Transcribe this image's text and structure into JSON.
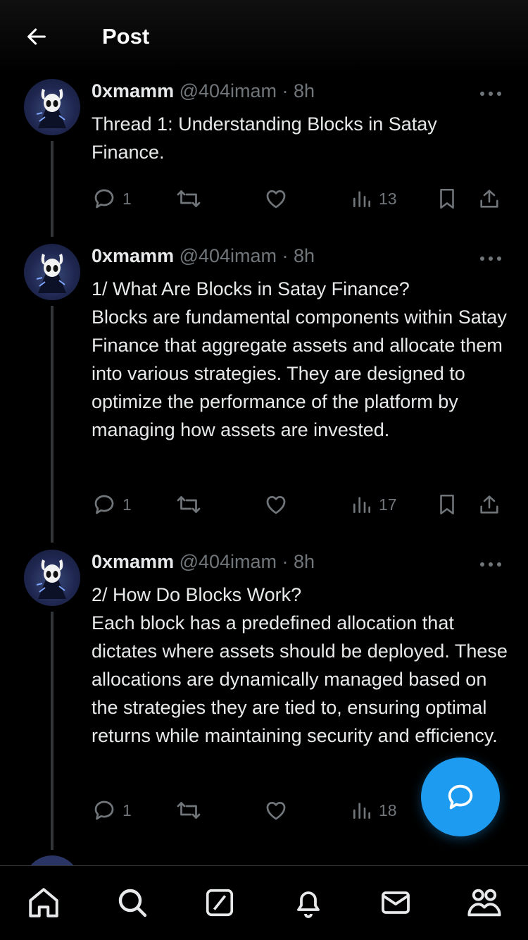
{
  "header": {
    "title": "Post"
  },
  "tweets": [
    {
      "name": "0xmamm",
      "meta": "@404imam · 8h",
      "text": "Thread 1: Understanding Blocks in Satay Finance.",
      "replies": "1",
      "views": "13"
    },
    {
      "name": "0xmamm",
      "meta": "@404imam · 8h",
      "text": "1/ What Are Blocks in Satay Finance?\nBlocks are fundamental components within Satay Finance that aggregate assets and allocate them into various strategies. They are designed to optimize the performance of the platform by managing how assets are invested.",
      "replies": "1",
      "views": "17"
    },
    {
      "name": "0xmamm",
      "meta": "@404imam · 8h",
      "text": "2/ How Do Blocks Work?\nEach block has a predefined allocation that dictates where assets should be deployed. These allocations are dynamically managed based on the strategies they are tied to, ensuring optimal returns while maintaining security and efficiency.",
      "replies": "1",
      "views": "18"
    }
  ],
  "colors": {
    "accent": "#1d9bf0",
    "muted": "#71767b",
    "text": "#e7e9ea"
  },
  "icons": [
    "back-arrow-icon",
    "more-icon",
    "reply-icon",
    "repost-icon",
    "like-icon",
    "views-icon",
    "bookmark-icon",
    "share-icon",
    "compose-icon",
    "home-icon",
    "search-icon",
    "grok-icon",
    "notifications-icon",
    "messages-icon",
    "communities-icon"
  ]
}
